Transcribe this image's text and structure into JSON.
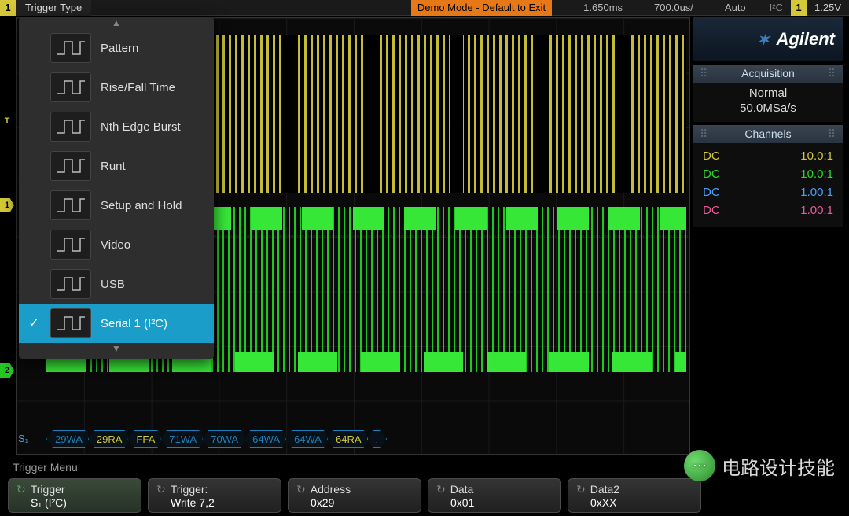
{
  "topbar": {
    "ch_left": "1",
    "trig_type_label": "Trigger Type",
    "demo": "Demo Mode - Default to Exit",
    "timebase": "1.650ms",
    "timediv": "700.0us/",
    "mode": "Auto",
    "protocol": "I²C",
    "ch_right": "1",
    "voltage": "1.25V"
  },
  "dropdown": {
    "items": [
      {
        "label": "Pattern"
      },
      {
        "label": "Rise/Fall Time"
      },
      {
        "label": "Nth Edge Burst"
      },
      {
        "label": "Runt"
      },
      {
        "label": "Setup and Hold"
      },
      {
        "label": "Video"
      },
      {
        "label": "USB"
      },
      {
        "label": "Serial 1 (I²C)"
      }
    ],
    "selected_index": 7
  },
  "right": {
    "brand": "Agilent",
    "acq_head": "Acquisition",
    "acq_mode": "Normal",
    "acq_rate": "50.0MSa/s",
    "ch_head": "Channels",
    "channels": [
      {
        "coupling": "DC",
        "ratio": "10.0:1",
        "color": "c-yellow"
      },
      {
        "coupling": "DC",
        "ratio": "10.0:1",
        "color": "c-green"
      },
      {
        "coupling": "DC",
        "ratio": "1.00:1",
        "color": "c-blue"
      },
      {
        "coupling": "DC",
        "ratio": "1.00:1",
        "color": "c-pink"
      }
    ]
  },
  "decode": {
    "label": "S₁",
    "packets": [
      {
        "text": "29WA",
        "cls": ""
      },
      {
        "text": "29RA",
        "cls": "y"
      },
      {
        "text": "FFA",
        "cls": "y"
      },
      {
        "text": "71WA",
        "cls": ""
      },
      {
        "text": "70WA",
        "cls": ""
      },
      {
        "text": "64WA",
        "cls": ""
      },
      {
        "text": "64WA",
        "cls": ""
      },
      {
        "text": "64RA",
        "cls": "y"
      },
      {
        "text": ".",
        "cls": "r"
      }
    ]
  },
  "bottom": {
    "menu_label": "Trigger Menu",
    "keys": [
      {
        "top": "Trigger",
        "bot": "S₁ (I²C)",
        "active": true,
        "icon": "refresh"
      },
      {
        "top": "Trigger:",
        "bot": "Write 7,2",
        "icon": "rotate"
      },
      {
        "top": "Address",
        "bot": "0x29",
        "icon": "rotate"
      },
      {
        "top": "Data",
        "bot": "0x01",
        "icon": "rotate"
      },
      {
        "top": "Data2",
        "bot": "0xXX",
        "icon": "rotate"
      }
    ]
  },
  "watermark": "电路设计技能",
  "markers": {
    "ch1": "1",
    "ch2": "2",
    "tlabel": "T"
  }
}
